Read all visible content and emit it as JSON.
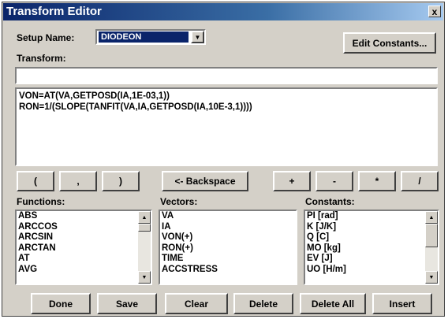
{
  "window": {
    "title": "Transform Editor",
    "close_label": "x"
  },
  "setup": {
    "label": "Setup Name:",
    "value": "DIODEON"
  },
  "edit_constants_label": "Edit Constants...",
  "transform": {
    "label": "Transform:",
    "input_value": "",
    "lines": [
      "VON=AT(VA,GETPOSD(IA,1E-03,1))",
      "RON=1/(SLOPE(TANFIT(VA,IA,GETPOSD(IA,10E-3,1))))"
    ]
  },
  "keypad": {
    "open_paren": "(",
    "comma": ",",
    "close_paren": ")",
    "backspace": "<- Backspace",
    "plus": "+",
    "minus": "-",
    "multiply": "*",
    "divide": "/"
  },
  "functions": {
    "label": "Functions:",
    "items": [
      "ABS",
      "ARCCOS",
      "ARCSIN",
      "ARCTAN",
      "AT",
      "AVG"
    ]
  },
  "vectors": {
    "label": "Vectors:",
    "items": [
      "VA",
      "IA",
      "VON(+)",
      "RON(+)",
      "TIME",
      "ACCSTRESS"
    ]
  },
  "constants": {
    "label": "Constants:",
    "items": [
      "PI [rad]",
      "K [J/K]",
      "Q [C]",
      "MO [kg]",
      "EV [J]",
      "UO [H/m]"
    ]
  },
  "actions": {
    "done": "Done",
    "save": "Save",
    "clear": "Clear",
    "delete": "Delete",
    "delete_all": "Delete All",
    "insert": "Insert"
  }
}
